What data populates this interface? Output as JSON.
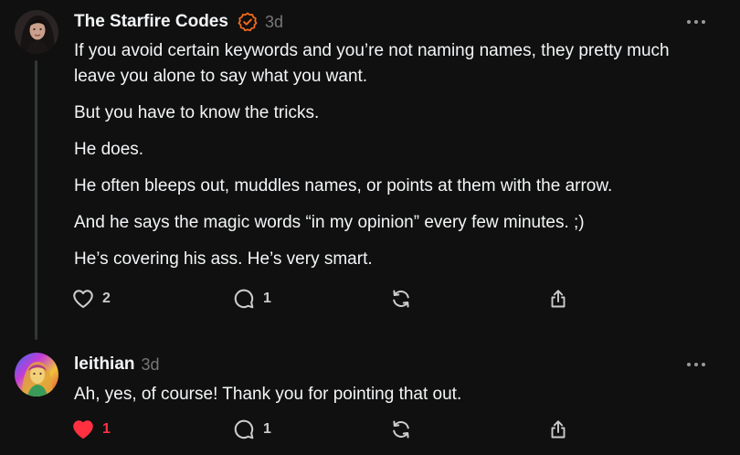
{
  "posts": [
    {
      "author": "The Starfire Codes",
      "verified": true,
      "time": "3d",
      "paragraphs": [
        "If you avoid certain keywords and you’re not naming names, they pretty much leave you alone to say what you want.",
        "But you have to know the tricks.",
        "He does.",
        "He often bleeps out, muddles names, or points at them with the arrow.",
        "And he says the magic words “in my opinion” every few minutes. ;)",
        "He’s covering his ass. He’s very smart."
      ],
      "likes": "2",
      "liked": false,
      "replies": "1"
    },
    {
      "author": "leithian",
      "verified": false,
      "time": "3d",
      "paragraphs": [
        "Ah, yes, of course! Thank you for pointing that out."
      ],
      "likes": "1",
      "liked": true,
      "replies": "1"
    }
  ],
  "colors": {
    "background": "#101010",
    "text": "#f3f5f7",
    "muted": "#777777",
    "verified_badge": "#f26a1b",
    "like_active": "#ff3040"
  },
  "icons": {
    "like": "heart-icon",
    "reply": "comment-bubble-icon",
    "repost": "repost-arrows-icon",
    "share": "share-arrow-icon",
    "more": "more-dots-icon",
    "verified": "verified-badge-icon"
  }
}
